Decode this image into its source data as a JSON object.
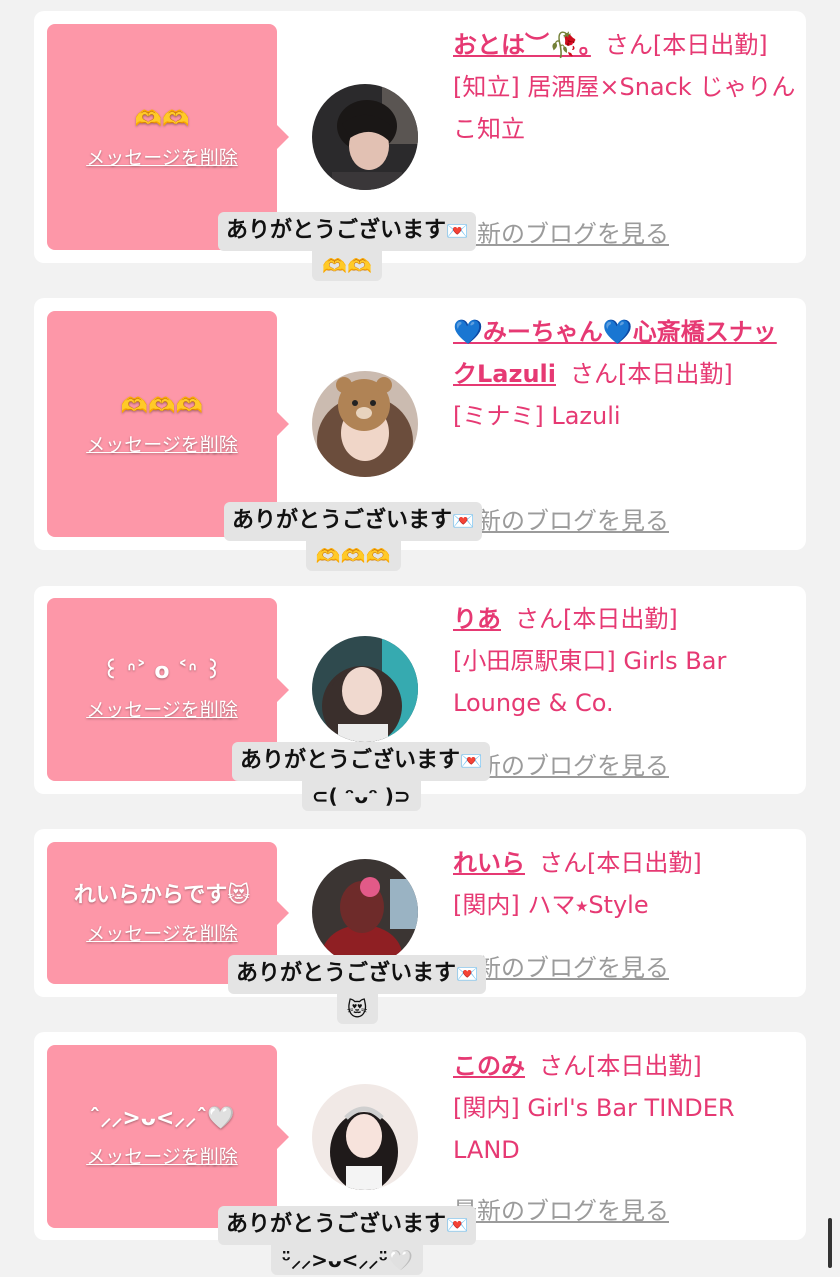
{
  "common": {
    "san_label": "さん[本日出勤]",
    "delete_label": "メッセージを削除",
    "blog_label": "最新のブログを見る",
    "reply_label": "ありがとうございます",
    "reply_icon": "💌"
  },
  "cards": [
    {
      "name": "おとは︶🥀｡",
      "shop": "[知立] 居酒屋×Snack じゃりんこ知立",
      "message": "🫶🫶",
      "reply_sub": "🫶🫶"
    },
    {
      "name": "💙みーちゃん💙心斎橋スナックLazuli",
      "shop": "[ミナミ] Lazuli",
      "message": "🫶🫶🫶",
      "reply_sub": "🫶🫶🫶"
    },
    {
      "name": "りあ",
      "shop": "[小田原駅東口] Girls Bar Lounge & Co.",
      "message": "꒰ ᐢ˃ o ˂ᐢ ꒱",
      "reply_sub": "⊂( ᵔᴗᵔ )⊃"
    },
    {
      "name": "れいら",
      "shop": "[関内] ハマ⭑Style",
      "message": "れいらからです😻",
      "reply_sub": "😻"
    },
    {
      "name": "このみ",
      "shop": "[関内] Girl's Bar TINDER LAND",
      "message": "ˆ⸝⸝>ᴗ<⸝⸝ˆ🤍",
      "reply_sub": "ᵕ̈⸝⸝>ᴗ<⸝⸝ᵕ̈🤍"
    }
  ]
}
